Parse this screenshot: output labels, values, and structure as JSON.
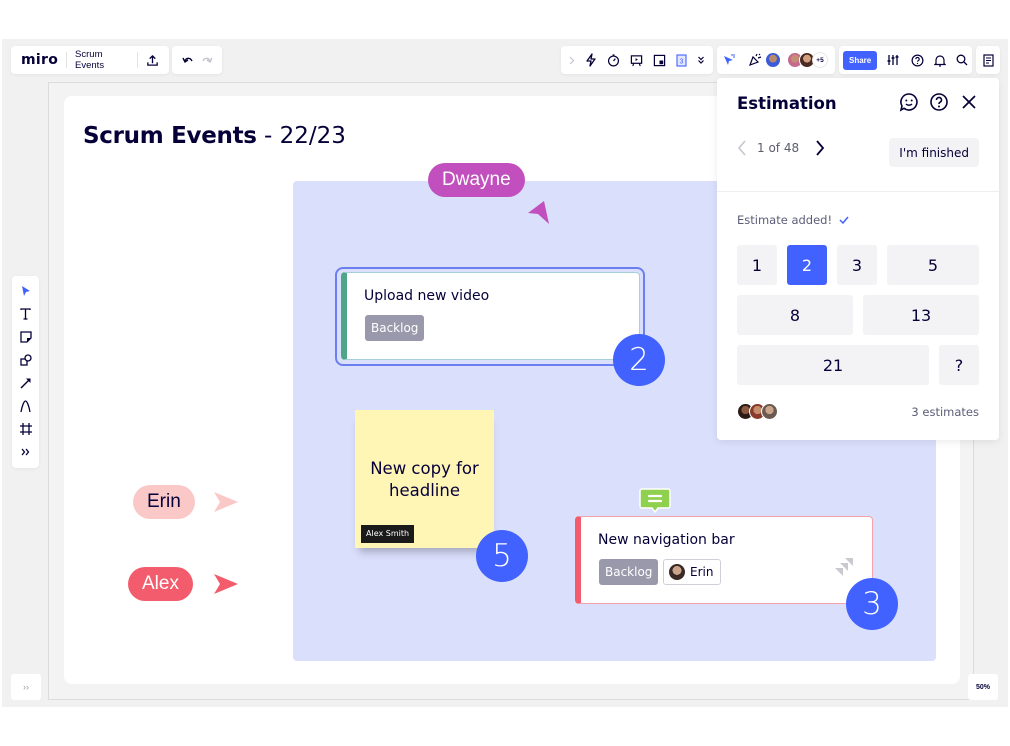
{
  "header": {
    "logo": "miro",
    "board_name": "Scrum Events",
    "icons": {
      "export": "upload-icon",
      "undo": "undo-icon",
      "redo": "redo-icon"
    }
  },
  "toolbar_right": {
    "tools": [
      "chevron-right-icon",
      "lightning-icon",
      "timer-icon",
      "presentation-icon",
      "frame-image-icon",
      "estimation-icon",
      "chevrons-down-icon"
    ],
    "collab": [
      "cursor-follow-icon",
      "celebrate-icon"
    ],
    "collaborator_count_more": "+5",
    "share_label": "Share",
    "utility": [
      "settings-sliders-icon",
      "help-icon",
      "bell-icon",
      "search-icon"
    ],
    "notes_icon": "notes-icon"
  },
  "left_toolbar": {
    "tools": [
      {
        "name": "select-tool",
        "icon": "cursor-icon"
      },
      {
        "name": "text-tool",
        "icon": "text-icon"
      },
      {
        "name": "sticky-note-tool",
        "icon": "sticky-note-icon"
      },
      {
        "name": "shapes-tool",
        "icon": "shapes-icon"
      },
      {
        "name": "connector-tool",
        "icon": "arrow-icon"
      },
      {
        "name": "pen-tool",
        "icon": "pen-icon"
      },
      {
        "name": "frame-tool",
        "icon": "frame-icon"
      },
      {
        "name": "more-tools",
        "icon": "chevrons-right-icon"
      }
    ]
  },
  "board": {
    "title_bold": "Scrum Events",
    "title_rest": " - 22/23",
    "cursors": [
      {
        "name": "Dwayne",
        "color": "#c14fbe"
      },
      {
        "name": "Erin",
        "color": "#fbc8c8"
      },
      {
        "name": "Alex",
        "color": "#f25c6c"
      }
    ],
    "cards": [
      {
        "title": "Upload new video",
        "status": "Backlog",
        "estimate": "2",
        "accent": "#4fa588"
      },
      {
        "title": "New navigation bar",
        "status": "Backlog",
        "assignee": "Erin",
        "estimate": "3",
        "accent": "#f25c6c"
      }
    ],
    "sticky": {
      "text": "New copy for headline",
      "author": "Alex Smith",
      "estimate": "5"
    }
  },
  "estimation": {
    "title": "Estimation",
    "pager": "1 of 48",
    "finished_label": "I'm finished",
    "status": "Estimate added!",
    "options": [
      "1",
      "2",
      "3",
      "5",
      "8",
      "13",
      "21",
      "?"
    ],
    "selected": "2",
    "estimates_count": "3 estimates"
  },
  "footer": {
    "expand_label": "››",
    "zoom": "50%"
  },
  "colors": {
    "accent": "#4262ff",
    "frame_bg": "#dadffc",
    "sticky": "#fff6b6"
  }
}
